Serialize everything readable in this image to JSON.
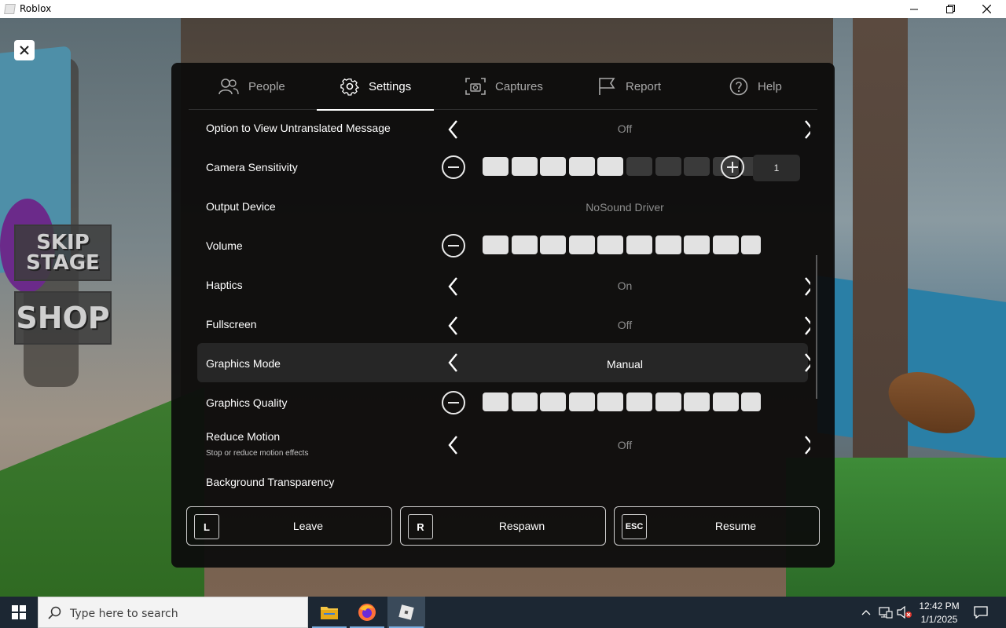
{
  "window": {
    "title": "Roblox"
  },
  "game": {
    "skip_stage": "SKIP STAGE",
    "shop": "SHOP"
  },
  "tabs": [
    {
      "label": "People",
      "icon": "people-icon"
    },
    {
      "label": "Settings",
      "icon": "gear-icon",
      "active": true
    },
    {
      "label": "Captures",
      "icon": "camera-icon"
    },
    {
      "label": "Report",
      "icon": "flag-icon"
    },
    {
      "label": "Help",
      "icon": "help-icon"
    }
  ],
  "settings": {
    "untranslated": {
      "label": "Option to View Untranslated Message",
      "value": "Off"
    },
    "camera": {
      "label": "Camera Sensitivity",
      "level": 5,
      "max": 10,
      "value": "1"
    },
    "output": {
      "label": "Output Device",
      "value": "NoSound Driver"
    },
    "volume": {
      "label": "Volume",
      "level": 10,
      "max": 10
    },
    "haptics": {
      "label": "Haptics",
      "value": "On"
    },
    "fullscreen": {
      "label": "Fullscreen",
      "value": "Off"
    },
    "graphics_mode": {
      "label": "Graphics Mode",
      "value": "Manual"
    },
    "graphics_quality": {
      "label": "Graphics Quality",
      "level": 10,
      "max": 10
    },
    "reduce_motion": {
      "label": "Reduce Motion",
      "sublabel": "Stop or reduce motion effects",
      "value": "Off"
    },
    "bg_transparency": {
      "label": "Background Transparency",
      "level": 0,
      "max": 10
    }
  },
  "actions": {
    "leave": {
      "key": "L",
      "label": "Leave"
    },
    "respawn": {
      "key": "R",
      "label": "Respawn"
    },
    "resume": {
      "key": "ESC",
      "label": "Resume"
    }
  },
  "taskbar": {
    "search_placeholder": "Type here to search",
    "time": "12:42 PM",
    "date": "1/1/2025"
  },
  "colors": {
    "menu_bg": "#0c0c0c",
    "segment_on": "#e2e2e2",
    "segment_off": "#3a3a3a",
    "taskbar": "#1c2733"
  }
}
